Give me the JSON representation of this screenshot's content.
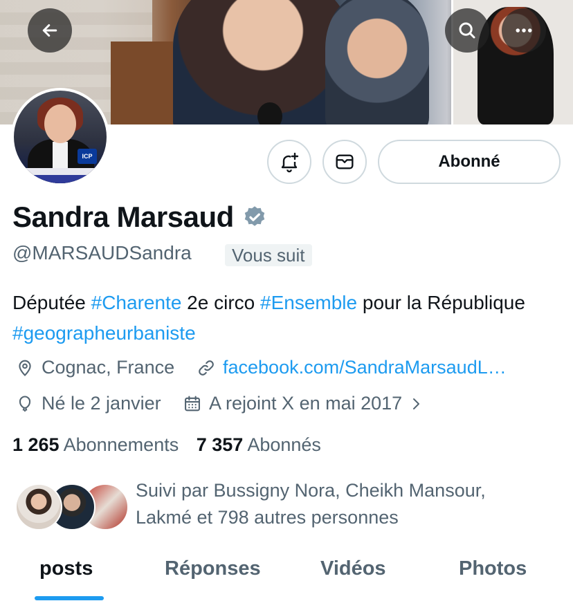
{
  "header": {
    "back_icon": "arrow-left-icon",
    "search_icon": "search-icon",
    "more_icon": "more-horizontal-icon"
  },
  "profile": {
    "name": "Sandra Marsaud",
    "handle": "@MARSAUDSandra",
    "follows_you": "Vous suit",
    "verified_icon": "verified-badge-icon",
    "verified_color": "#829aab",
    "avatar_caption": "ICP"
  },
  "actions": {
    "notify_icon": "bell-plus-icon",
    "message_icon": "envelope-icon",
    "follow_label": "Abonné"
  },
  "bio": {
    "parts": [
      {
        "text": "Députée ",
        "tag": false
      },
      {
        "text": "#Charente",
        "tag": true
      },
      {
        "text": " 2e circo ",
        "tag": false
      },
      {
        "text": "#Ensemble",
        "tag": true
      },
      {
        "text": " pour la République ",
        "tag": false
      },
      {
        "text": "#geographeurbaniste",
        "tag": true
      }
    ]
  },
  "meta": {
    "location": "Cognac, France",
    "website": "facebook.com/SandraMarsaudL…",
    "birthday": "Né le 2 janvier",
    "joined": "A rejoint X en mai 2017"
  },
  "stats": {
    "following_count": "1 265",
    "following_label": "Abonnements",
    "followers_count": "7 357",
    "followers_label": "Abonnés"
  },
  "followed_by": {
    "text_line1": "Suivi par Bussigny Nora, Cheikh Mansour,",
    "text_line2": "Lakmé et 798 autres personnes"
  },
  "tabs": [
    {
      "label": "posts",
      "active": true
    },
    {
      "label": "Réponses",
      "active": false
    },
    {
      "label": "Vidéos",
      "active": false
    },
    {
      "label": "Photos",
      "active": false
    }
  ],
  "colors": {
    "accent": "#1d9bf0",
    "text": "#0f1419",
    "secondary": "#536471"
  }
}
